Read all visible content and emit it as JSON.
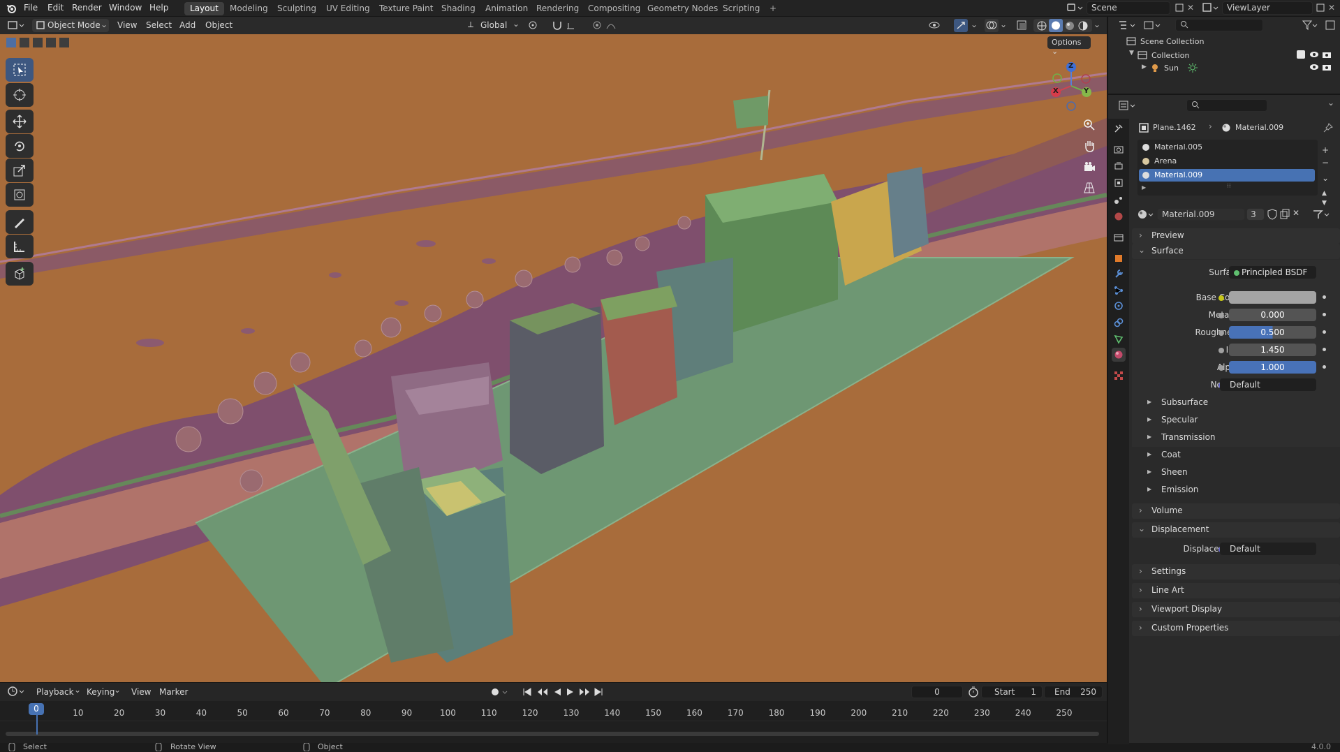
{
  "topbar": {
    "menus": [
      "File",
      "Edit",
      "Render",
      "Window",
      "Help"
    ],
    "workspaces": [
      "Layout",
      "Modeling",
      "Sculpting",
      "UV Editing",
      "Texture Paint",
      "Shading",
      "Animation",
      "Rendering",
      "Compositing",
      "Geometry Nodes",
      "Scripting"
    ],
    "active_workspace": "Layout",
    "scene": "Scene",
    "view_layer": "ViewLayer"
  },
  "viewport_header": {
    "mode": "Object Mode",
    "menus": [
      "View",
      "Select",
      "Add",
      "Object"
    ],
    "transform_orientation": "Global",
    "options": "Options"
  },
  "gizmo": {
    "z": "Z",
    "y": "Y",
    "x": "X"
  },
  "outliner": {
    "scene_collection": "Scene Collection",
    "collection": "Collection",
    "sun": "Sun"
  },
  "properties": {
    "breadcrumb_object": "Plane.1462",
    "breadcrumb_material": "Material.009",
    "material_slots": [
      "Material.005",
      "Arena",
      "Material.009"
    ],
    "active_slot": "Material.009",
    "material_name": "Material.009",
    "material_users": "3",
    "sections": {
      "preview": "Preview",
      "surface": "Surface",
      "volume": "Volume",
      "displacement": "Displacement",
      "settings": "Settings",
      "line_art": "Line Art",
      "viewport_display": "Viewport Display",
      "custom_properties": "Custom Properties"
    },
    "surface_label": "Surface",
    "surface_value": "Principled BSDF",
    "inputs": {
      "base_color_label": "Base Color",
      "metallic_label": "Metallic",
      "metallic": "0.000",
      "roughness_label": "Roughness",
      "roughness": "0.500",
      "ior_label": "IOR",
      "ior": "1.450",
      "alpha_label": "Alpha",
      "alpha": "1.000",
      "normal_label": "Normal",
      "normal": "Default"
    },
    "subpanels": [
      "Subsurface",
      "Specular",
      "Transmission",
      "Coat",
      "Sheen",
      "Emission"
    ],
    "displacement_label": "Displacement",
    "displacement_value": "Default",
    "colors": {
      "base_color": "#a4a4a4",
      "active_blue": "#4872b8",
      "node_dot": "#c7c719"
    }
  },
  "timeline": {
    "menus": [
      "Playback",
      "Keying",
      "View",
      "Marker"
    ],
    "current_frame": "0",
    "start_label": "Start",
    "start": "1",
    "end_label": "End",
    "end": "250",
    "ticks": [
      "0",
      "10",
      "20",
      "30",
      "40",
      "50",
      "60",
      "70",
      "80",
      "90",
      "100",
      "110",
      "120",
      "130",
      "140",
      "150",
      "160",
      "170",
      "180",
      "190",
      "200",
      "210",
      "220",
      "230",
      "240",
      "250"
    ]
  },
  "statusbar": {
    "select": "Select",
    "rotate_view": "Rotate View",
    "object": "Object",
    "version": "4.0.0"
  }
}
